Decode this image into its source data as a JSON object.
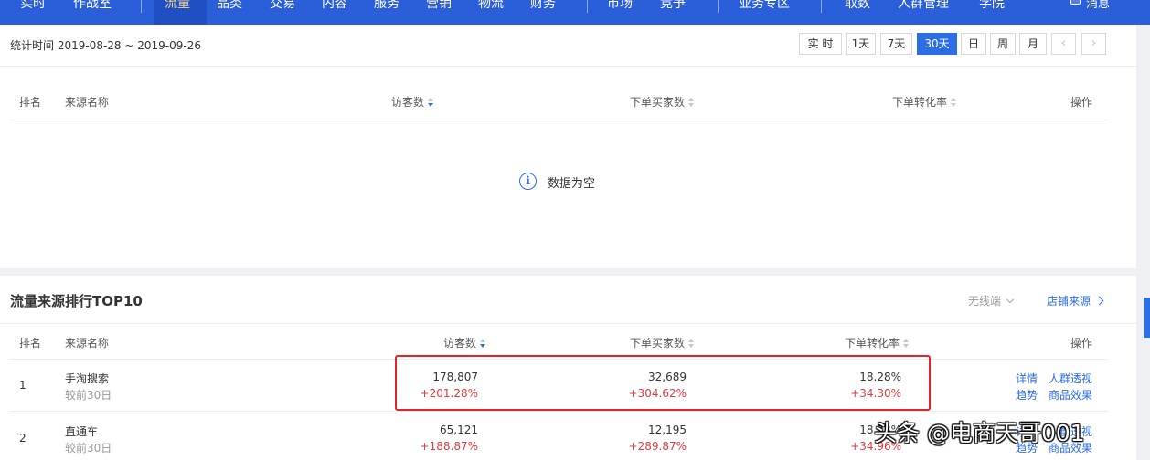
{
  "nav": {
    "items": [
      "实时",
      "作战室",
      "流量",
      "品类",
      "交易",
      "内容",
      "服务",
      "营销",
      "物流",
      "财务",
      "市场",
      "竞争",
      "业务专区",
      "取数",
      "人群管理",
      "学院"
    ],
    "active": "流量",
    "message": "消息"
  },
  "panel1": {
    "stat_time": "统计时间 2019-08-28 ~ 2019-09-26",
    "periods": [
      "实 时",
      "1天",
      "7天",
      "30天",
      "日",
      "周",
      "月"
    ],
    "active_period": "30天",
    "columns": [
      "排名",
      "来源名称",
      "访客数",
      "下单买家数",
      "下单转化率",
      "操作"
    ],
    "empty_text": "数据为空"
  },
  "panel2": {
    "title": "流量来源排行TOP10",
    "device": "无线端",
    "shop_source": "店铺来源",
    "columns": [
      "排名",
      "来源名称",
      "访客数",
      "下单买家数",
      "下单转化率",
      "操作"
    ],
    "rows": [
      {
        "rank": "1",
        "name": "手淘搜索",
        "sub": "较前30日",
        "visitors": "178,807",
        "visitors_delta": "+201.28%",
        "buyers": "32,689",
        "buyers_delta": "+304.62%",
        "rate": "18.28%",
        "rate_delta": "+34.30%",
        "ops": [
          "详情",
          "人群透视",
          "趋势",
          "商品效果"
        ]
      },
      {
        "rank": "2",
        "name": "直通车",
        "sub": "较前30日",
        "visitors": "65,121",
        "visitors_delta": "+188.87%",
        "buyers": "12,195",
        "buyers_delta": "+289.87%",
        "rate": "18.73%",
        "rate_delta": "+34.96%",
        "ops": [
          "详情",
          "人群透视",
          "趋势",
          "商品效果"
        ]
      }
    ]
  },
  "watermark": "头条 @电商天哥001",
  "colors": {
    "nav_bg": "#2b5fd9",
    "accent": "#2b6de5",
    "positive": "#e4393c",
    "highlight": "#e0242a"
  }
}
